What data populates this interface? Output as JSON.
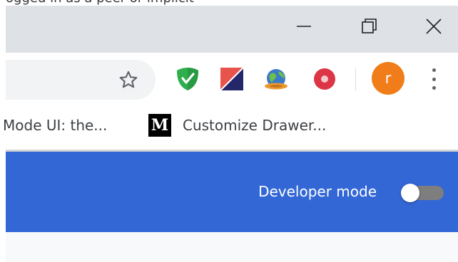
{
  "top_strip": {
    "text": "ogged in as a peer or implicit"
  },
  "window_controls": {
    "minimize_icon": "minimize-icon",
    "restore_icon": "restore-icon",
    "close_icon": "close-icon"
  },
  "toolbar": {
    "bookmark_star_icon": "star-outline-icon",
    "extensions": [
      {
        "name": "green-shield-icon",
        "color": "#2fae4e"
      },
      {
        "name": "red-blue-flag-icon",
        "color": "#e8534b"
      },
      {
        "name": "globe-icon",
        "color": "#3b7ac9"
      },
      {
        "name": "red-record-icon",
        "color": "#dc3545"
      }
    ],
    "avatar_initial": "r",
    "avatar_color": "#f07d1a",
    "menu_icon": "three-dots-vertical-icon"
  },
  "bookmarks": [
    {
      "label": "Mode UI: the..."
    },
    {
      "label": "Customize Drawer...",
      "icon_letter": "M"
    }
  ],
  "extensions_page": {
    "developer_mode_label": "Developer mode",
    "developer_mode_on": false,
    "header_color": "#3367d6"
  }
}
